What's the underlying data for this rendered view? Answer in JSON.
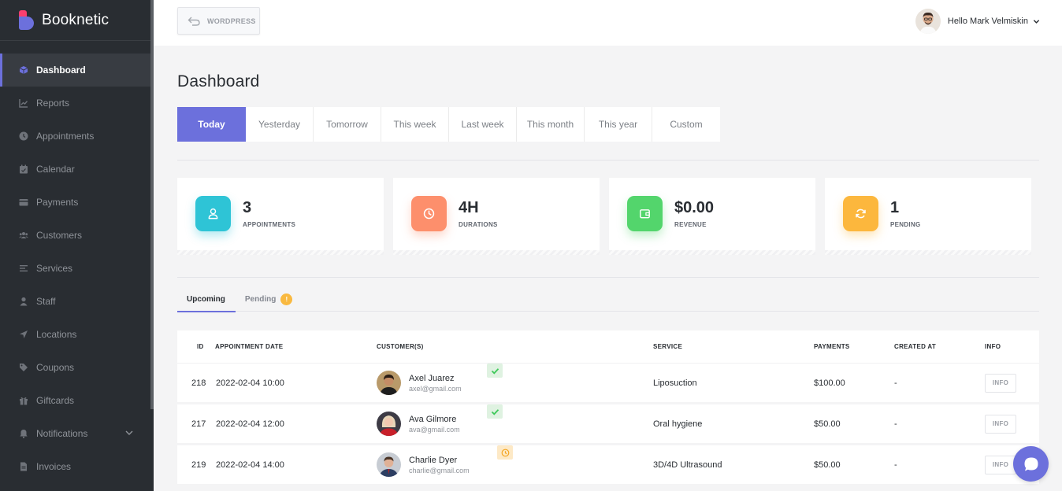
{
  "brand": {
    "name": "Booknetic"
  },
  "sidebar": {
    "items": [
      {
        "label": "Dashboard",
        "icon": "cube-icon",
        "active": true
      },
      {
        "label": "Reports",
        "icon": "chart-icon"
      },
      {
        "label": "Appointments",
        "icon": "clock-icon"
      },
      {
        "label": "Calendar",
        "icon": "calendar-icon"
      },
      {
        "label": "Payments",
        "icon": "credit-card-icon"
      },
      {
        "label": "Customers",
        "icon": "users-icon"
      },
      {
        "label": "Services",
        "icon": "list-icon"
      },
      {
        "label": "Staff",
        "icon": "user-icon"
      },
      {
        "label": "Locations",
        "icon": "location-arrow-icon"
      },
      {
        "label": "Coupons",
        "icon": "tag-icon"
      },
      {
        "label": "Giftcards",
        "icon": "gift-icon"
      },
      {
        "label": "Notifications",
        "icon": "bell-icon"
      },
      {
        "label": "Invoices",
        "icon": "file-icon"
      }
    ]
  },
  "topbar": {
    "back_label": "WORDPRESS",
    "greeting": "Hello Mark Velmiskin"
  },
  "page": {
    "title": "Dashboard"
  },
  "periods": [
    "Today",
    "Yesterday",
    "Tomorrow",
    "This week",
    "Last week",
    "This month",
    "This year",
    "Custom"
  ],
  "stats": [
    {
      "value": "3",
      "label": "APPOINTMENTS",
      "color": "#2ec4d6",
      "icon": "user-icon"
    },
    {
      "value": "4H",
      "label": "DURATIONS",
      "color": "#fd8f6c",
      "icon": "clock-icon"
    },
    {
      "value": "$0.00",
      "label": "REVENUE",
      "color": "#53d56c",
      "icon": "wallet-icon"
    },
    {
      "value": "1",
      "label": "PENDING",
      "color": "#fcb73d",
      "icon": "sync-icon"
    }
  ],
  "tabs": {
    "upcoming": "Upcoming",
    "pending": "Pending",
    "pending_count": "!"
  },
  "table": {
    "headers": {
      "id": "ID",
      "date": "APPOINTMENT DATE",
      "customers": "CUSTOMER(S)",
      "service": "SERVICE",
      "payments": "PAYMENTS",
      "created": "CREATED AT",
      "info": "INFO"
    },
    "rows": [
      {
        "id": "218",
        "date": "2022-02-04 10:00",
        "name": "Axel Juarez",
        "email": "axel@gmail.com",
        "status": "approved",
        "service": "Liposuction",
        "payment": "$100.00",
        "created": "-",
        "info": "INFO"
      },
      {
        "id": "217",
        "date": "2022-02-04 12:00",
        "name": "Ava Gilmore",
        "email": "ava@gmail.com",
        "status": "approved",
        "service": "Oral hygiene",
        "payment": "$50.00",
        "created": "-",
        "info": "INFO"
      },
      {
        "id": "219",
        "date": "2022-02-04 14:00",
        "name": "Charlie Dyer",
        "email": "charlie@gmail.com",
        "status": "pending",
        "service": "3D/4D Ultrasound",
        "payment": "$50.00",
        "created": "-",
        "info": "INFO"
      }
    ]
  },
  "colors": {
    "accent": "#6c70dc",
    "sidebar_bg": "#292d32",
    "approved": "#53d56c",
    "pending": "#fcb73d"
  }
}
